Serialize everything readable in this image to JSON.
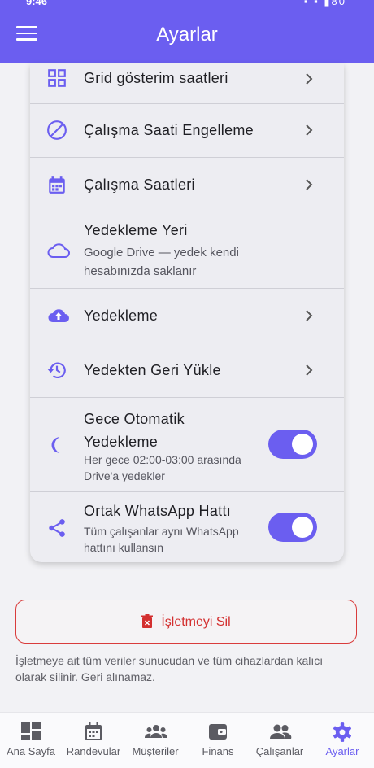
{
  "status_bar": {
    "time": "9:46",
    "battery": "80"
  },
  "app_bar": {
    "title": "Ayarlar",
    "menu_icon": "menu-icon"
  },
  "settings": [
    {
      "label": "Grid gösterim saatleri",
      "icon": "grid-icon"
    },
    {
      "label": "Çalışma Saati Engelleme",
      "icon": "block-icon"
    },
    {
      "label": "Çalışma Saatleri",
      "icon": "calendar-icon"
    },
    {
      "label": "Yedekleme Yeri",
      "sub": "Google Drive — yedek kendi hesabınızda saklanır",
      "icon": "cloud-icon"
    },
    {
      "label": "Yedekleme",
      "icon": "cloud-upload-icon"
    },
    {
      "label": "Yedekten Geri Yükle",
      "icon": "restore-icon"
    },
    {
      "label": "Gece Otomatik Yedekleme",
      "sub": "Her gece 02:00-03:00 arasında Drive'a yedekler",
      "icon": "moon-icon",
      "toggle": true
    },
    {
      "label": "Ortak WhatsApp Hattı",
      "sub": "Tüm çalışanlar aynı WhatsApp hattını kullansın",
      "icon": "share-icon",
      "toggle": true
    }
  ],
  "danger": {
    "button_label": "İşletmeyi Sil",
    "icon": "trash-icon",
    "warning": "İşletmeye ait tüm veriler sunucudan ve tüm cihazlardan kalıcı olarak silinir. Geri alınamaz."
  },
  "bottom_nav": [
    {
      "label": "Ana Sayfa",
      "icon": "dashboard-icon"
    },
    {
      "label": "Randevular",
      "icon": "calendar-icon"
    },
    {
      "label": "Müşteriler",
      "icon": "groups-icon"
    },
    {
      "label": "Finans",
      "icon": "wallet-icon"
    },
    {
      "label": "Çalışanlar",
      "icon": "people-icon"
    },
    {
      "label": "Ayarlar",
      "icon": "settings-icon",
      "active": true
    }
  ],
  "colors": {
    "primary": "#6b5ef0",
    "danger": "#d32f2f"
  }
}
